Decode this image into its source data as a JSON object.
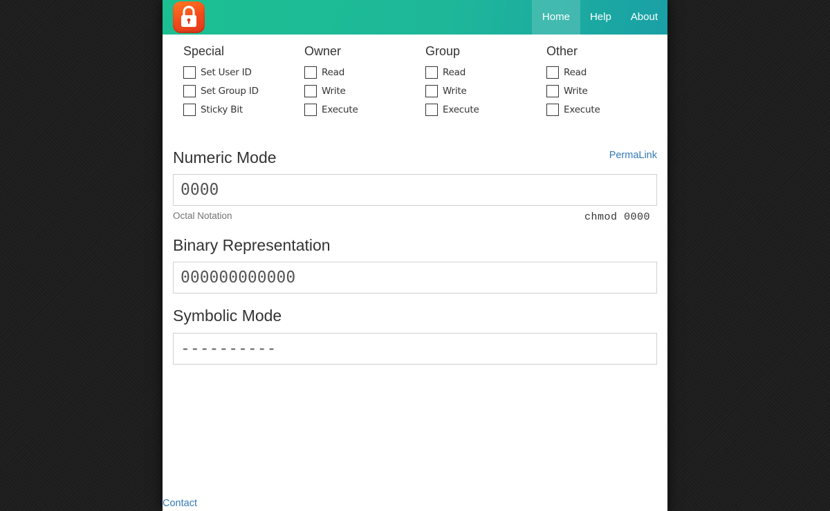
{
  "nav": {
    "items": [
      {
        "label": "Home",
        "active": true
      },
      {
        "label": "Help",
        "active": false
      },
      {
        "label": "About",
        "active": false
      }
    ]
  },
  "groups": [
    {
      "title": "Special",
      "options": [
        {
          "label": "Set User ID",
          "checked": false
        },
        {
          "label": "Set Group ID",
          "checked": false
        },
        {
          "label": "Sticky Bit",
          "checked": false
        }
      ]
    },
    {
      "title": "Owner",
      "options": [
        {
          "label": "Read",
          "checked": false
        },
        {
          "label": "Write",
          "checked": false
        },
        {
          "label": "Execute",
          "checked": false
        }
      ]
    },
    {
      "title": "Group",
      "options": [
        {
          "label": "Read",
          "checked": false
        },
        {
          "label": "Write",
          "checked": false
        },
        {
          "label": "Execute",
          "checked": false
        }
      ]
    },
    {
      "title": "Other",
      "options": [
        {
          "label": "Read",
          "checked": false
        },
        {
          "label": "Write",
          "checked": false
        },
        {
          "label": "Execute",
          "checked": false
        }
      ]
    }
  ],
  "numeric": {
    "title": "Numeric Mode",
    "permalink": "PermaLink",
    "value": "0000",
    "help": "Octal Notation",
    "command": "chmod 0000"
  },
  "binary": {
    "title": "Binary Representation",
    "value": "000000000000"
  },
  "symbolic": {
    "title": "Symbolic Mode",
    "value": "----------"
  },
  "footer": {
    "contact": "Contact"
  },
  "colors": {
    "navbar_start": "#1cbf92",
    "navbar_end": "#1aa0a6",
    "logo": "#f2491c",
    "link": "#337ab7"
  },
  "icons": {
    "logo": "padlock-icon"
  }
}
